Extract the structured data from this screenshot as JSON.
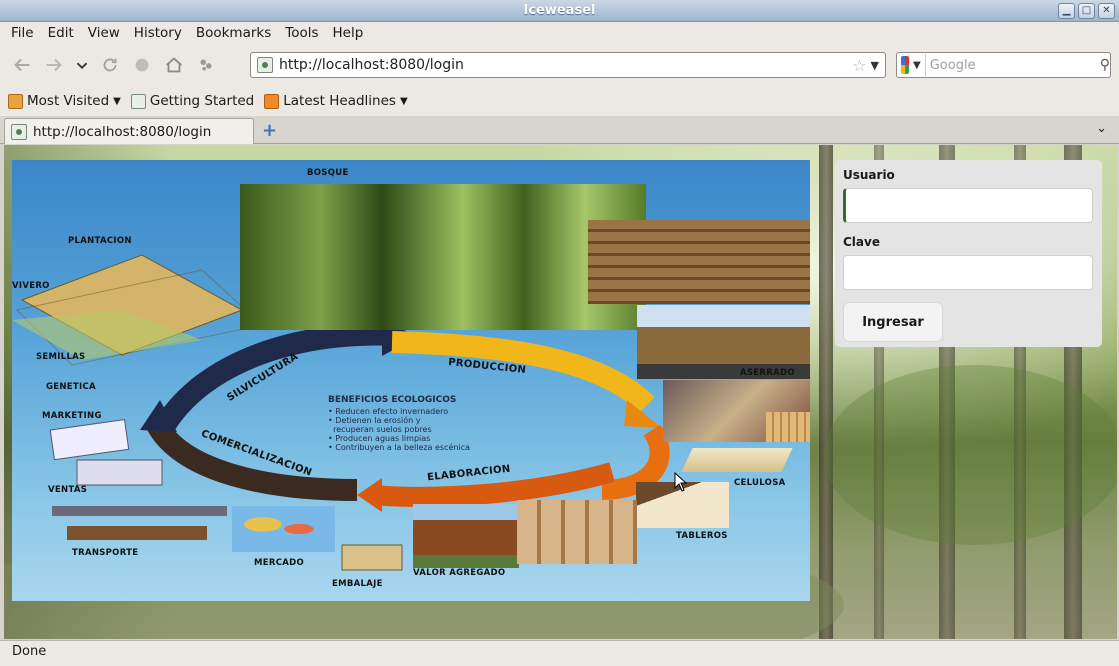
{
  "window": {
    "title": "Iceweasel",
    "controls": [
      "▁",
      "□",
      "✕"
    ]
  },
  "menu": [
    {
      "label": "File"
    },
    {
      "label": "Edit"
    },
    {
      "label": "View"
    },
    {
      "label": "History"
    },
    {
      "label": "Bookmarks"
    },
    {
      "label": "Tools"
    },
    {
      "label": "Help"
    }
  ],
  "navigation": {
    "url": "http://localhost:8080/login",
    "search_placeholder": "Google",
    "icons": [
      "back-icon",
      "forward-icon",
      "history-dropdown-icon",
      "reload-icon",
      "stop-icon",
      "home-icon",
      "plugin-icon"
    ]
  },
  "bookmarks": [
    {
      "label": "Most Visited",
      "has_dropdown": true
    },
    {
      "label": "Getting Started",
      "has_dropdown": false
    },
    {
      "label": "Latest Headlines",
      "has_dropdown": true
    }
  ],
  "tabs": [
    {
      "label": "http://localhost:8080/login"
    }
  ],
  "poster": {
    "labels": {
      "bosque": "BOSQUE",
      "plantacion": "PLANTACION",
      "vivero": "VIVERO",
      "semillas": "SEMILLAS",
      "genetica": "GENETICA",
      "marketing": "MARKETING",
      "ventas": "VENTAS",
      "transporte": "TRANSPORTE",
      "mercado": "MERCADO",
      "embalaje": "EMBALAJE",
      "valor_agregado": "VALOR AGREGADO",
      "tableros": "TABLEROS",
      "celulosa": "CELULOSA",
      "aserrado": "ASERRADO",
      "silvicultura": "SILVICULTURA",
      "produccion": "PRODUCCION",
      "elaboracion": "ELABORACION",
      "comercializacion": "COMERCIALIZACION"
    },
    "beneficios_title": "BENEFICIOS ECOLOGICOS",
    "beneficios_items": [
      "• Reducen efecto invernadero",
      "• Detienen la erosión y",
      "  recuperan suelos pobres",
      "• Producen aguas limpias",
      "• Contribuyen a la belleza escénica"
    ]
  },
  "login": {
    "usuario_label": "Usuario",
    "clave_label": "Clave",
    "submit_label": "Ingresar",
    "usuario_value": "",
    "clave_value": ""
  },
  "status": {
    "text": "Done"
  },
  "colors": {
    "titlebar": "#9fb4cc",
    "chrome": "#ece9e4",
    "poster_sky": "#3b86c8",
    "accent_focus": "#2d6e2d"
  }
}
